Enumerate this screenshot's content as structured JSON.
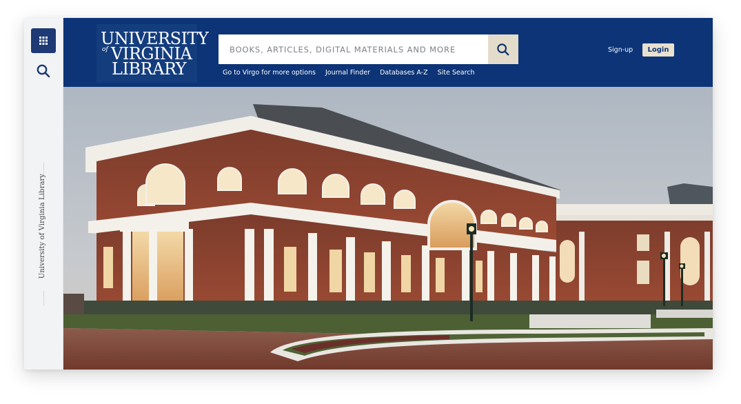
{
  "rail": {
    "apps_icon": "apps-grid-icon",
    "search_icon": "search-icon",
    "vertical_label": "University of Virginia Library"
  },
  "header": {
    "logo": {
      "line1": "UNIVERSITY",
      "of": "of",
      "line2": "VIRGINIA",
      "line3": "LIBRARY"
    },
    "search": {
      "placeholder": "BOOKS, ARTICLES, DIGITAL MATERIALS AND MORE",
      "value": "",
      "button_icon": "search-icon"
    },
    "quick_links": [
      "Go to Virgo for more options",
      "Journal Finder",
      "Databases A-Z",
      "Site Search"
    ],
    "signup_label": "Sign-up",
    "login_label": "Login"
  },
  "hero": {
    "image": "library-building-photo"
  },
  "colors": {
    "header_bg": "#0c3477",
    "accent_tan": "#e4dccb",
    "rail_bg": "#f2f3f4"
  }
}
